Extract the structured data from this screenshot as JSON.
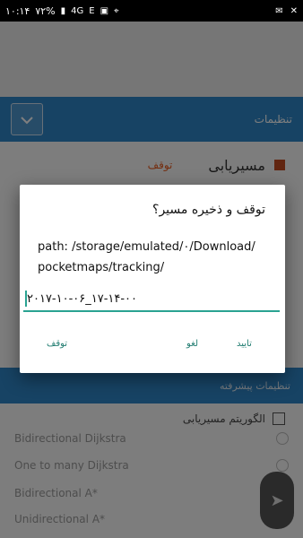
{
  "status_bar": {
    "time": "۱۰:۱۴",
    "battery": "۷۲%",
    "network": "4G",
    "left_icons": [
      "battery-icon",
      "signal-icon",
      "network-icon",
      "e-icon",
      "doc-icon",
      "location-icon"
    ],
    "right_icons": [
      "mail-icon",
      "close-icon"
    ]
  },
  "background": {
    "settings_title": "تنظیمات",
    "routing_label": "مسیریابی",
    "routing_state": "توقف",
    "advanced_title": "تنظیمات پیشرفته",
    "algorithm_label": "الگوریتم مسیریابی",
    "options": [
      "Bidirectional Dijkstra",
      "One to many Dijkstra",
      "Bidirectional A*",
      "Unidirectional A*"
    ]
  },
  "dialog": {
    "title": "توقف و ذخیره مسیر؟",
    "path_line1": "path: /storage/emulated/۰/Download/",
    "path_line2": "pocketmaps/tracking/",
    "input_value": "۲۰۱۷-۱۰-۰۶_۱۷-۱۴-۰۰",
    "buttons": {
      "confirm": "تایید",
      "cancel": "لغو",
      "stop": "توقف"
    }
  },
  "colors": {
    "primary": "#2f86c9",
    "accent": "#2aa392",
    "stop_red": "#e85d20"
  }
}
